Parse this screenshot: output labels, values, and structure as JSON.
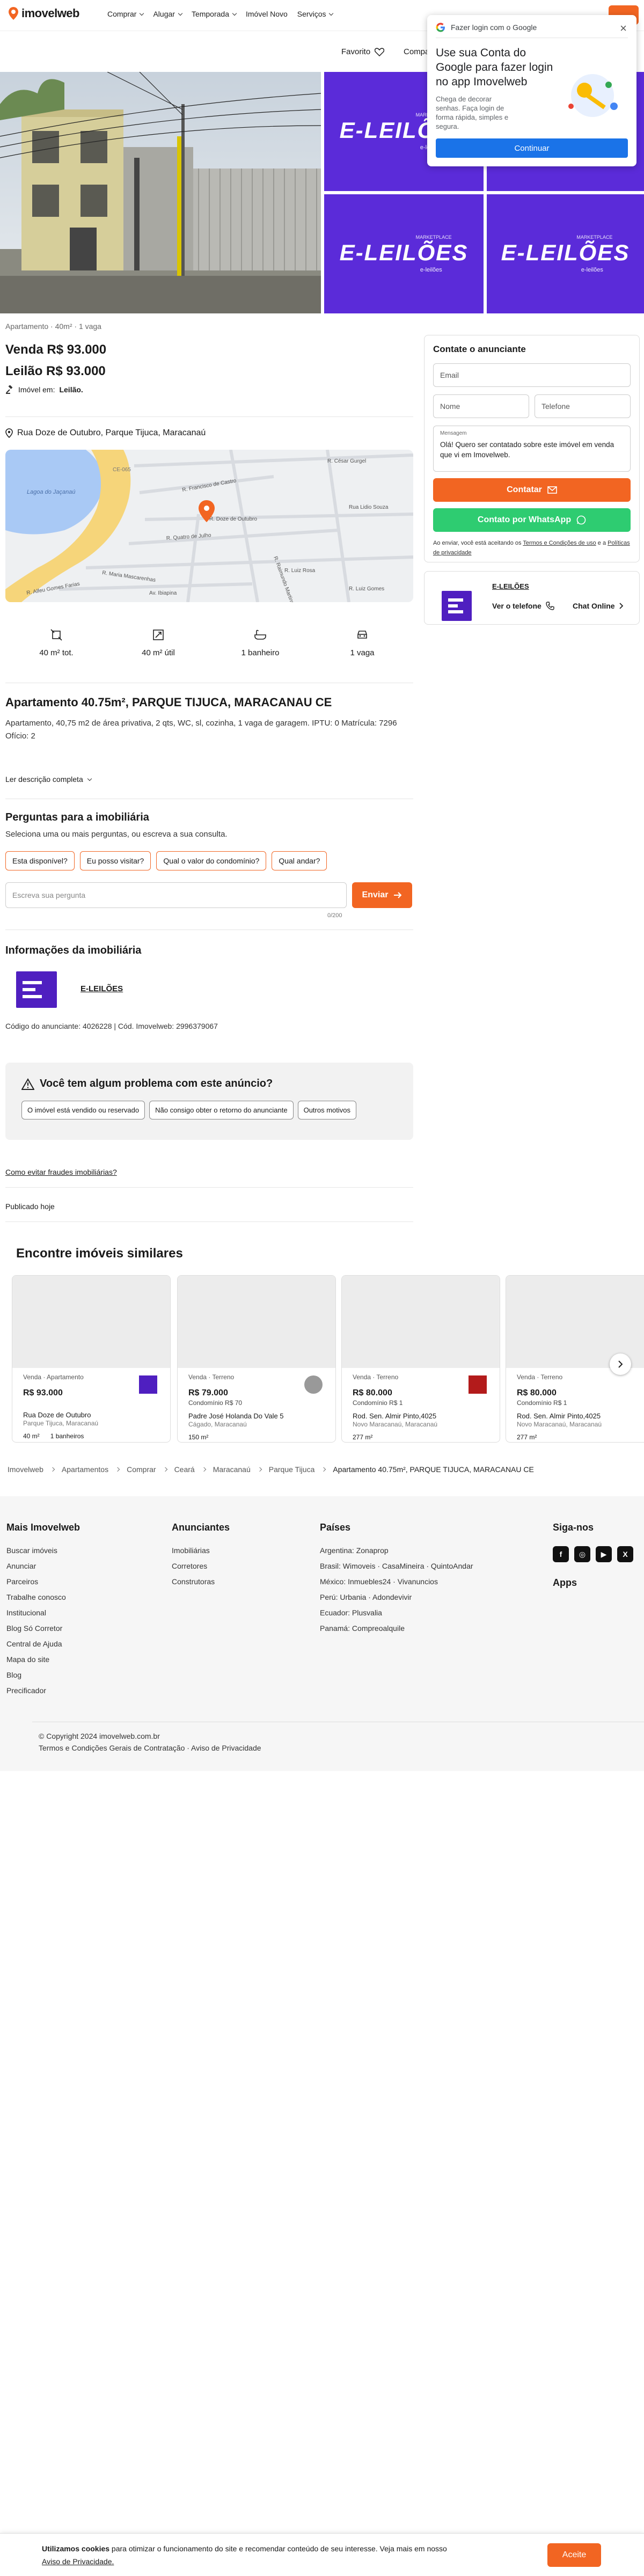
{
  "header": {
    "logo_text": "imovelweb",
    "nav": [
      "Comprar",
      "Alugar",
      "Temporada",
      "Imóvel Novo",
      "Serviços"
    ],
    "favorite_label": "Favorito",
    "share_label": "Compa"
  },
  "google_prompt": {
    "header": "Fazer login com o Google",
    "title": "Use sua Conta do Google para fazer login no app Imovelweb",
    "body": "Chega de decorar senhas. Faça login de forma rápida, simples e segura.",
    "button": "Continuar",
    "close": "×"
  },
  "gallery": {
    "tile_logo": "E-LEILÕES",
    "tile_small_top": "MARKETPLACE",
    "tile_small": "e-leilões"
  },
  "listing": {
    "summary": "Apartamento · 40m² · 1 vaga",
    "sale_price": "Venda R$ 93.000",
    "auction_price": "Leilão R$ 93.000",
    "tag_prefix": "Imóvel em:",
    "tag_value": "Leilão.",
    "address": "Rua Doze de Outubro, Parque Tijuca, Maracanaú",
    "features": [
      {
        "icon": "area-total-icon",
        "label": "40 m² tot."
      },
      {
        "icon": "area-util-icon",
        "label": "40 m² útil"
      },
      {
        "icon": "bathroom-icon",
        "label": "1 banheiro"
      },
      {
        "icon": "parking-icon",
        "label": "1 vaga"
      }
    ],
    "title": "Apartamento 40.75m², PARQUE TIJUCA, MARACANAU CE",
    "description": "Apartamento, 40,75 m2 de área privativa, 2 qts, WC, sl, cozinha, 1 vaga de garagem. IPTU: 0 Matrícula: 7296 Ofício: 2",
    "read_more": "Ler descrição completa"
  },
  "map": {
    "labels": [
      "R. César Gurgel",
      "R. Francisco de Castro",
      "R. Doze de Outubro",
      "R. Quatro de Julho",
      "R. Maria Mascarenhas",
      "R. Raimundo Martins",
      "R. Alfeu Gomes Farias",
      "R. Luiz Rosa",
      "R. Luiz Gomes",
      "Rua Lidio Souza",
      "Av. Ibiapina",
      "CE-065",
      "Lagoa do Jaçanaú"
    ]
  },
  "questions": {
    "title": "Perguntas para a imobiliária",
    "subtitle": "Seleciona uma ou mais perguntas, ou escreva a sua consulta.",
    "chips": [
      "Esta disponível?",
      "Eu posso visitar?",
      "Qual o valor do condomínio?",
      "Qual andar?"
    ],
    "placeholder": "Escreva sua pergunta",
    "send": "Enviar",
    "counter": "0/200"
  },
  "agency": {
    "title": "Informações da imobiliária",
    "name": "E-LEILÕES",
    "codes": "Código do anunciante: 4026228 | Cód. Imovelweb: 2996379067"
  },
  "problem": {
    "title": "Você tem algum problema com este anúncio?",
    "options": [
      "O imóvel está vendido ou reservado",
      "Não consigo obter o retorno do anunciante",
      "Outros motivos"
    ]
  },
  "fraud_link": "Como evitar fraudes imobiliárias?",
  "published": "Publicado hoje",
  "contact": {
    "title": "Contate o anunciante",
    "email": "Email",
    "name": "Nome",
    "phone": "Telefone",
    "message_label": "Mensagem",
    "message": "Olá! Quero ser contatado sobre este imóvel em venda que vi em Imovelweb.",
    "contact_btn": "Contatar",
    "whatsapp_btn": "Contato por WhatsApp",
    "terms_prefix": "Ao enviar, você está aceitando os",
    "terms_link1": "Termos e Condições de uso",
    "terms_mid": "e a",
    "terms_link2": "Políticas de privacidade"
  },
  "advertiser_card": {
    "name": "E-LEILÕES",
    "see_phone": "Ver o telefone",
    "chat": "Chat Online"
  },
  "similar": {
    "title": "Encontre imóveis similares",
    "cards": [
      {
        "type": "Venda · Apartamento",
        "price": "R$ 93.000",
        "sub": "",
        "addr": "Rua Doze de Outubro",
        "city": "Parque Tijuca, Maracanaú",
        "f1": "40 m²",
        "f2": "1 banheiros"
      },
      {
        "type": "Venda · Terreno",
        "price": "R$ 79.000",
        "sub": "Condomínio R$ 70",
        "addr": "Padre José Holanda Do Vale 5",
        "city": "Cágado, Maracanaú",
        "f1": "150 m²",
        "f2": ""
      },
      {
        "type": "Venda · Terreno",
        "price": "R$ 80.000",
        "sub": "Condomínio R$ 1",
        "addr": "Rod. Sen. Almir Pinto,4025",
        "city": "Novo Maracanaú, Maracanaú",
        "f1": "277 m²",
        "f2": ""
      },
      {
        "type": "Venda · Terreno",
        "price": "R$ 80.000",
        "sub": "Condomínio R$ 1",
        "addr": "Rod. Sen. Almir Pinto,4025",
        "city": "Novo Maracanaú, Maracanaú",
        "f1": "277 m²",
        "f2": ""
      }
    ]
  },
  "breadcrumbs": [
    "Imovelweb",
    "Apartamentos",
    "Comprar",
    "Ceará",
    "Maracanaú",
    "Parque Tijuca",
    "Apartamento 40.75m², PARQUE TIJUCA, MARACANAU CE"
  ],
  "footer": {
    "col1_title": "Mais Imovelweb",
    "col1": [
      "Buscar imóveis",
      "Anunciar",
      "Parceiros",
      "Trabalhe conosco",
      "Institucional",
      "Blog Só Corretor",
      "Central de Ajuda",
      "Mapa do site",
      "Blog",
      "Precificador"
    ],
    "col2_title": "Anunciantes",
    "col2": [
      "Imobiliárias",
      "Corretores",
      "Construtoras"
    ],
    "col3_title": "Países",
    "col3": [
      "Argentina: Zonaprop",
      "Brasil: Wimoveis · CasaMineira · QuintoAndar",
      "México: Inmuebles24 · Vivanuncios",
      "Perú: Urbania · Adondevivir",
      "Ecuador: Plusvalia",
      "Panamá: Compreoalquile"
    ],
    "col4_title": "Siga-nos",
    "apps_title": "Apps",
    "copyright": "© Copyright 2024 imovelweb.com.br",
    "terms": "Termos e Condições Gerais de Contratação · Aviso de Privacidade"
  },
  "cookie": {
    "strong": "Utilizamos cookies",
    "text": " para otimizar o funcionamento do site e recomendar conteúdo de seu interesse. Veja mais em nosso",
    "link": "Aviso de Privacidade.",
    "button": "Aceite"
  },
  "colors": {
    "accent": "#f26522",
    "brand_purple": "#5b2bd9",
    "google_blue": "#1a73e8",
    "whatsapp": "#2ecc71"
  }
}
